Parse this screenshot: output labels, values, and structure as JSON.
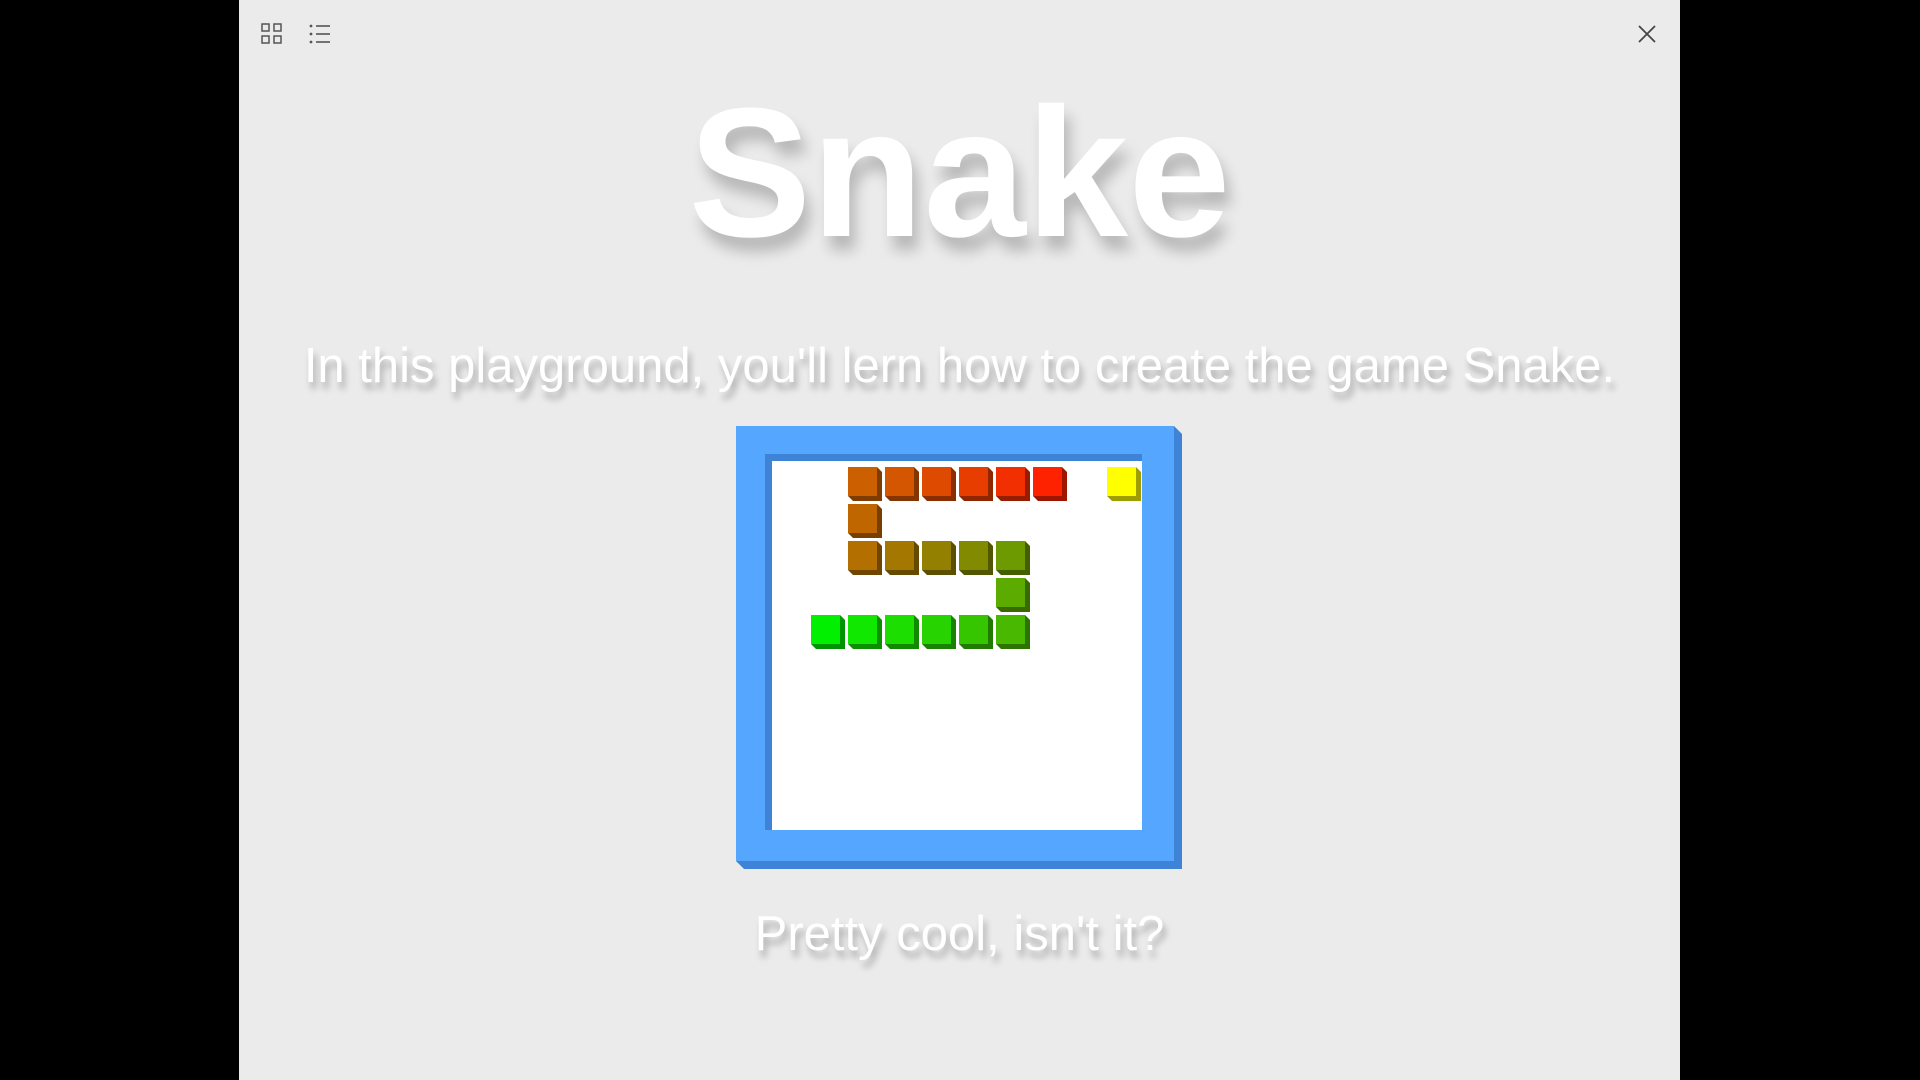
{
  "toolbar": {
    "grid_icon": "grid-view-icon",
    "list_icon": "list-view-icon",
    "close_icon": "close-icon"
  },
  "content": {
    "title": "Snake",
    "subtitle": "In this playground, you'll lern how to create the game Snake.",
    "footer": "Pretty cool, isn't it?"
  },
  "game": {
    "board_color": "#55a6ff",
    "board_shadow_color": "#3f83d6",
    "field_color": "#ffffff",
    "grid_size": 9,
    "snake": [
      {
        "col": 5,
        "row": 3,
        "color": "#ff2200"
      },
      {
        "col": 4,
        "row": 3,
        "color": "#f22f00"
      },
      {
        "col": 3,
        "row": 3,
        "color": "#e83d00"
      },
      {
        "col": 2,
        "row": 3,
        "color": "#de4a00"
      },
      {
        "col": 1,
        "row": 3,
        "color": "#d55600"
      },
      {
        "col": 0,
        "row": 3,
        "color": "#cc6000"
      },
      {
        "col": 0,
        "row": 4,
        "color": "#c06600"
      },
      {
        "col": 0,
        "row": 5,
        "color": "#b37000"
      },
      {
        "col": 1,
        "row": 5,
        "color": "#a47800"
      },
      {
        "col": 2,
        "row": 5,
        "color": "#948000"
      },
      {
        "col": 3,
        "row": 5,
        "color": "#828b00"
      },
      {
        "col": 4,
        "row": 5,
        "color": "#6c9a00"
      },
      {
        "col": 4,
        "row": 6,
        "color": "#5bab00"
      },
      {
        "col": 4,
        "row": 7,
        "color": "#48b900"
      },
      {
        "col": 3,
        "row": 7,
        "color": "#36c600"
      },
      {
        "col": 2,
        "row": 7,
        "color": "#27d300"
      },
      {
        "col": 1,
        "row": 7,
        "color": "#1cde00"
      },
      {
        "col": 0,
        "row": 7,
        "color": "#10e800"
      },
      {
        "col": -1,
        "row": 7,
        "color": "#00f000"
      }
    ],
    "food": {
      "col": 7,
      "row": 3,
      "color": "#ffff00"
    }
  }
}
